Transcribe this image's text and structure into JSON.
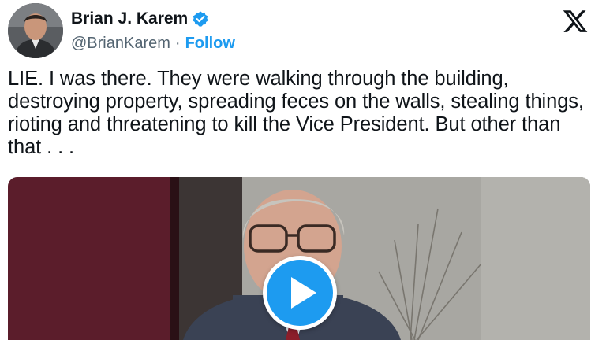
{
  "author": {
    "display_name": "Brian J. Karem",
    "handle": "@BrianKarem",
    "separator": "·",
    "follow_label": "Follow",
    "verified_icon": "verified-badge-icon",
    "avatar_icon": "profile-avatar"
  },
  "platform": {
    "logo_icon": "x-logo-icon"
  },
  "tweet": {
    "text": "LIE. I was there. They were walking through the building, destroying property, spreading feces on the walls, stealing things, rioting and threatening to kill the Vice President. But other than that . . ."
  },
  "media": {
    "type": "video",
    "play_icon": "play-icon"
  },
  "colors": {
    "accent": "#1d9bf0",
    "text": "#0f1419",
    "secondary_text": "#536471"
  }
}
